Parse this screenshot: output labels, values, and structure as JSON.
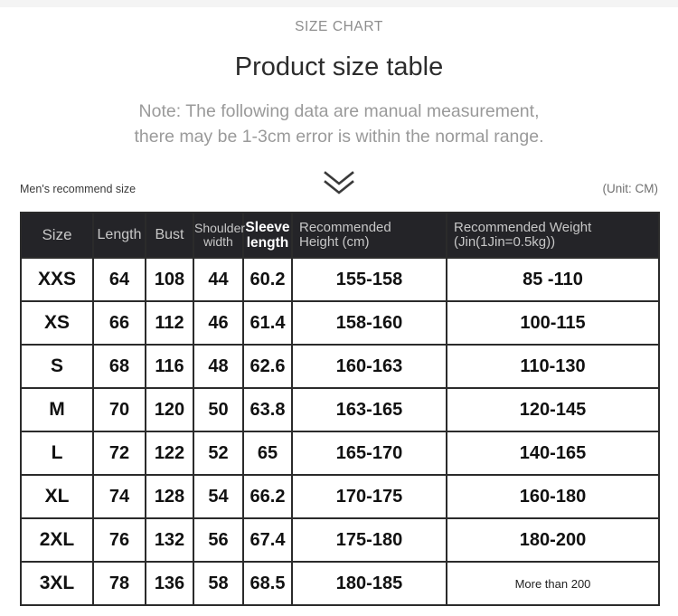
{
  "page": {
    "eyebrow": "SIZE CHART",
    "title": "Product size table",
    "note_line1": "Note: The following data are manual measurement,",
    "note_line2": "there may be 1-3cm error is within the normal range.",
    "chevron_icon": "double-chevron-down-icon",
    "meta_left": "Men's recommend size",
    "meta_right": "(Unit: CM)"
  },
  "colors": {
    "header_bg": "#242428",
    "header_text": "#c7c7c7",
    "header_text_highlight": "#ffffff",
    "border": "#2b2b2b",
    "title_text": "#2c2c2c",
    "note_text": "#9a9a9a",
    "eyebrow_text": "#8d8d8d",
    "top_strip": "#f4f4f4"
  },
  "table": {
    "columns": [
      {
        "key": "size",
        "label": "Size"
      },
      {
        "key": "length",
        "label": "Length"
      },
      {
        "key": "bust",
        "label": "Bust"
      },
      {
        "key": "shoulder_width",
        "label": "Shoulder width",
        "line1": "Shoulder",
        "line2": "width"
      },
      {
        "key": "sleeve_length",
        "label": "Sleeve length",
        "line1": "Sleeve",
        "line2": "length",
        "emphasis": true
      },
      {
        "key": "recommended_height",
        "label": "Recommended Height (cm)",
        "line1": "Recommended",
        "line2": "Height (cm)"
      },
      {
        "key": "recommended_weight",
        "label": "Recommended Weight (Jin(1Jin=0.5kg))",
        "line1": "Recommended Weight",
        "line2": "(Jin(1Jin=0.5kg))"
      }
    ],
    "rows": [
      {
        "size": "XXS",
        "length": "64",
        "bust": "108",
        "shoulder_width": "44",
        "sleeve_length": "60.2",
        "recommended_height": "155-158",
        "recommended_weight": "85 -110"
      },
      {
        "size": "XS",
        "length": "66",
        "bust": "112",
        "shoulder_width": "46",
        "sleeve_length": "61.4",
        "recommended_height": "158-160",
        "recommended_weight": "100-115"
      },
      {
        "size": "S",
        "length": "68",
        "bust": "116",
        "shoulder_width": "48",
        "sleeve_length": "62.6",
        "recommended_height": "160-163",
        "recommended_weight": "110-130"
      },
      {
        "size": "M",
        "length": "70",
        "bust": "120",
        "shoulder_width": "50",
        "sleeve_length": "63.8",
        "recommended_height": "163-165",
        "recommended_weight": "120-145"
      },
      {
        "size": "L",
        "length": "72",
        "bust": "122",
        "shoulder_width": "52",
        "sleeve_length": "65",
        "recommended_height": "165-170",
        "recommended_weight": "140-165"
      },
      {
        "size": "XL",
        "length": "74",
        "bust": "128",
        "shoulder_width": "54",
        "sleeve_length": "66.2",
        "recommended_height": "170-175",
        "recommended_weight": "160-180"
      },
      {
        "size": "2XL",
        "length": "76",
        "bust": "132",
        "shoulder_width": "56",
        "sleeve_length": "67.4",
        "recommended_height": "175-180",
        "recommended_weight": "180-200"
      },
      {
        "size": "3XL",
        "length": "78",
        "bust": "136",
        "shoulder_width": "58",
        "sleeve_length": "68.5",
        "recommended_height": "180-185",
        "recommended_weight": "More than 200",
        "recommended_weight_small": true
      }
    ]
  }
}
